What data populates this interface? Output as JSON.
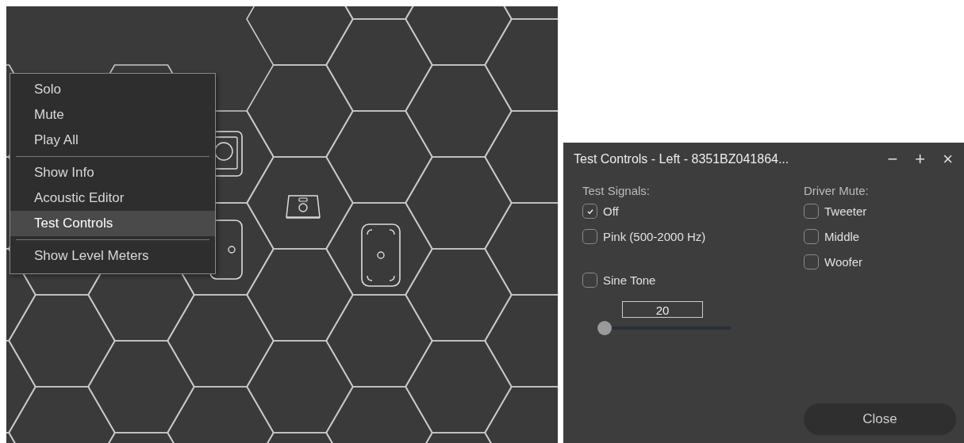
{
  "context_menu": {
    "items": [
      {
        "kind": "item",
        "label": "Solo",
        "selected": false
      },
      {
        "kind": "item",
        "label": "Mute",
        "selected": false
      },
      {
        "kind": "item",
        "label": "Play All",
        "selected": false
      },
      {
        "kind": "separator"
      },
      {
        "kind": "item",
        "label": "Show Info",
        "selected": false
      },
      {
        "kind": "item",
        "label": "Acoustic Editor",
        "selected": false
      },
      {
        "kind": "item",
        "label": "Test Controls",
        "selected": true
      },
      {
        "kind": "separator"
      },
      {
        "kind": "item",
        "label": "Show Level Meters",
        "selected": false
      }
    ]
  },
  "dialog": {
    "title": "Test Controls - Left - 8351BZ041864...",
    "window_buttons": [
      "−",
      "+",
      "×"
    ],
    "test_signals": {
      "heading": "Test Signals:",
      "options": [
        {
          "label": "Off",
          "checked": true
        },
        {
          "label": "Pink (500-2000 Hz)",
          "checked": false
        }
      ],
      "sine_tone": {
        "label": "Sine Tone",
        "checked": false
      }
    },
    "frequency": {
      "value": "20",
      "level": 0
    },
    "driver_mute": {
      "heading": "Driver Mute:",
      "options": [
        {
          "label": "Tweeter",
          "checked": false
        },
        {
          "label": "Middle",
          "checked": false
        },
        {
          "label": "Woofer",
          "checked": false
        }
      ]
    },
    "close_button": "Close"
  }
}
